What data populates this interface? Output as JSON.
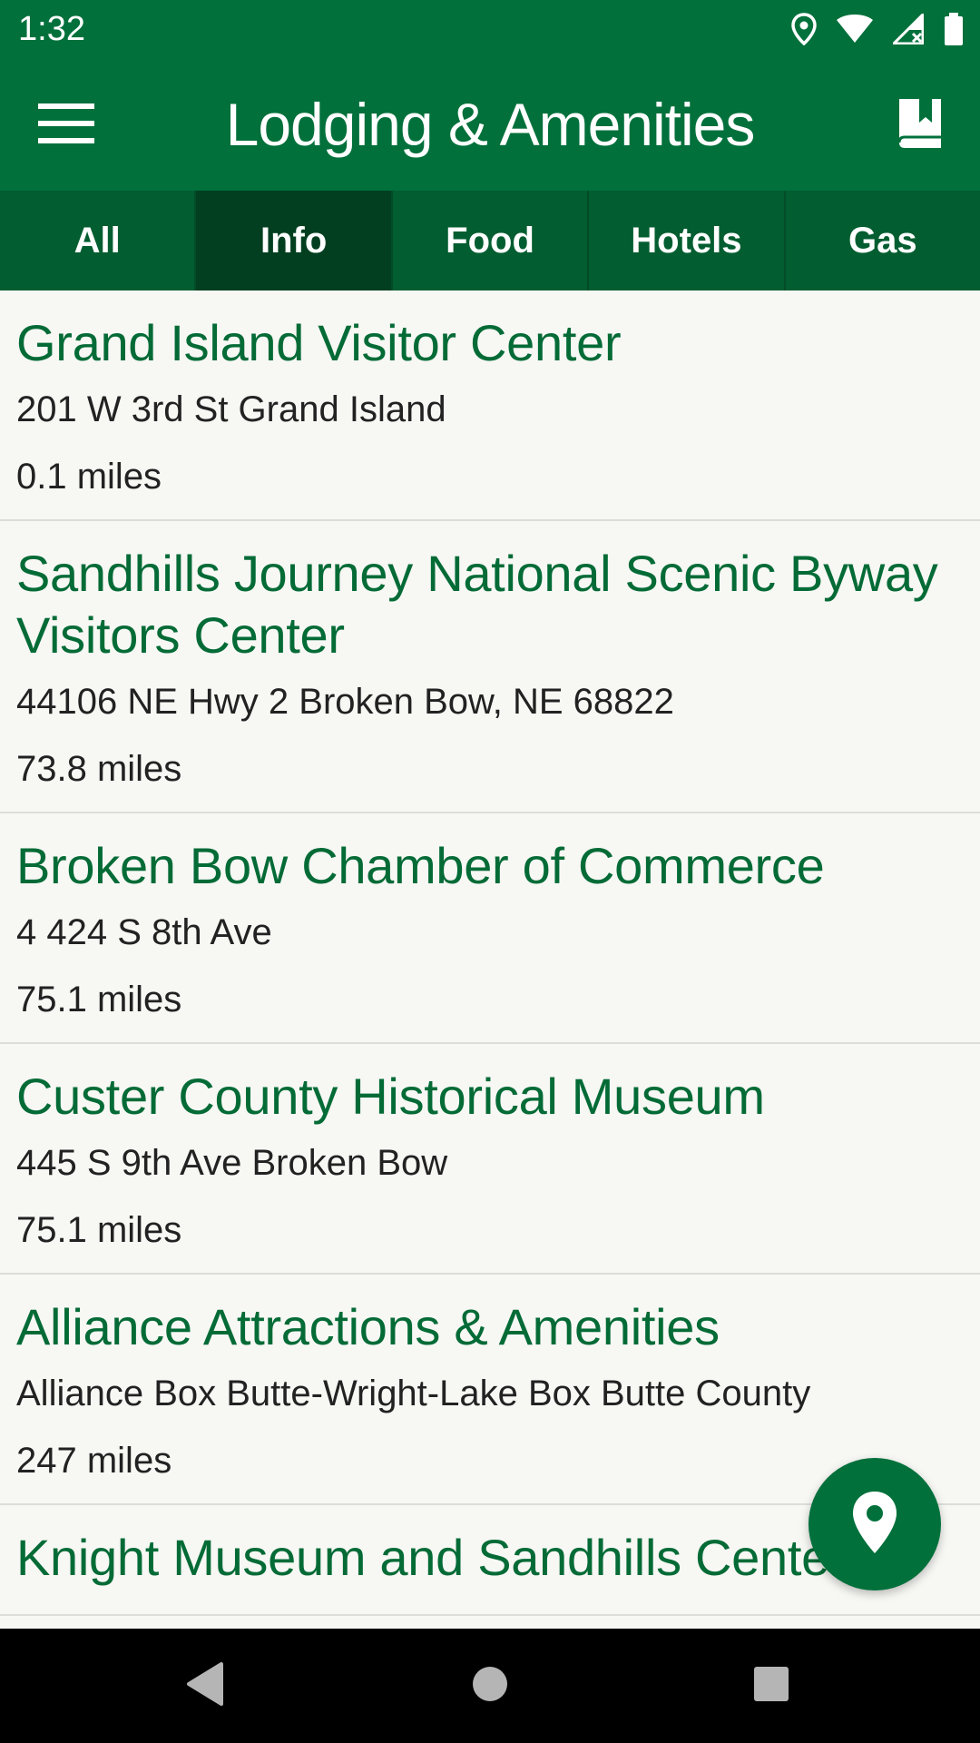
{
  "status_bar": {
    "time": "1:32",
    "icons": [
      "location-icon",
      "wifi-icon",
      "signal-icon",
      "battery-icon"
    ]
  },
  "app_bar": {
    "title": "Lodging & Amenities",
    "menu_icon": "hamburger-menu-icon",
    "bookmark_icon": "bookmark-book-icon"
  },
  "tabs": [
    {
      "label": "All",
      "active": false
    },
    {
      "label": "Info",
      "active": true
    },
    {
      "label": "Food",
      "active": false
    },
    {
      "label": "Hotels",
      "active": false
    },
    {
      "label": "Gas",
      "active": false
    }
  ],
  "items": [
    {
      "name": "Grand Island Visitor Center",
      "address": "201 W 3rd St Grand Island",
      "distance": "0.1 miles"
    },
    {
      "name": "Sandhills Journey National Scenic Byway Visitors Center",
      "address": "44106 NE Hwy 2 Broken Bow, NE 68822",
      "distance": "73.8 miles"
    },
    {
      "name": "Broken Bow Chamber of Commerce",
      "address": "4 424 S 8th Ave",
      "distance": "75.1 miles"
    },
    {
      "name": "Custer County Historical Museum",
      "address": "445 S 9th Ave Broken Bow",
      "distance": "75.1 miles"
    },
    {
      "name": "Alliance Attractions & Amenities",
      "address": "Alliance Box Butte-Wright-Lake Box Butte County",
      "distance": "247 miles"
    },
    {
      "name": "Knight Museum and Sandhills Center",
      "address": "",
      "distance": ""
    }
  ],
  "fab": {
    "icon": "map-pin-icon"
  },
  "nav_bar": {
    "icons": [
      "back-icon",
      "home-icon",
      "recents-icon"
    ]
  },
  "colors": {
    "primary": "#01703b",
    "tab_bg": "#025d30",
    "tab_active": "#023f20",
    "item_title": "#046b36",
    "background": "#f7f7f4"
  }
}
